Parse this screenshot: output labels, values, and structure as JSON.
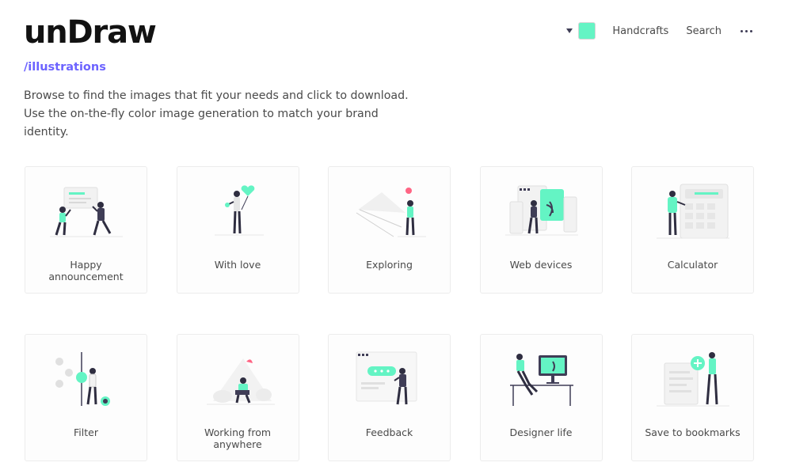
{
  "brand": {
    "logo": "unDraw"
  },
  "breadcrumb": "/illustrations",
  "intro": "Browse to find the images that fit your needs and click to download. Use the on-the-fly color image generation to match your brand identity.",
  "nav": {
    "accent_color": "#64f4c4",
    "links": [
      "Handcrafts",
      "Search"
    ],
    "more_icon": "ellipsis-icon"
  },
  "colors": {
    "accent": "#64f4c4",
    "ink": "#3f3d56",
    "link": "#6c63ff"
  },
  "illustrations": [
    {
      "label": "Happy announcement"
    },
    {
      "label": "With love"
    },
    {
      "label": "Exploring"
    },
    {
      "label": "Web devices"
    },
    {
      "label": "Calculator"
    },
    {
      "label": "Filter"
    },
    {
      "label": "Working from anywhere"
    },
    {
      "label": "Feedback"
    },
    {
      "label": "Designer life"
    },
    {
      "label": "Save to bookmarks"
    }
  ]
}
